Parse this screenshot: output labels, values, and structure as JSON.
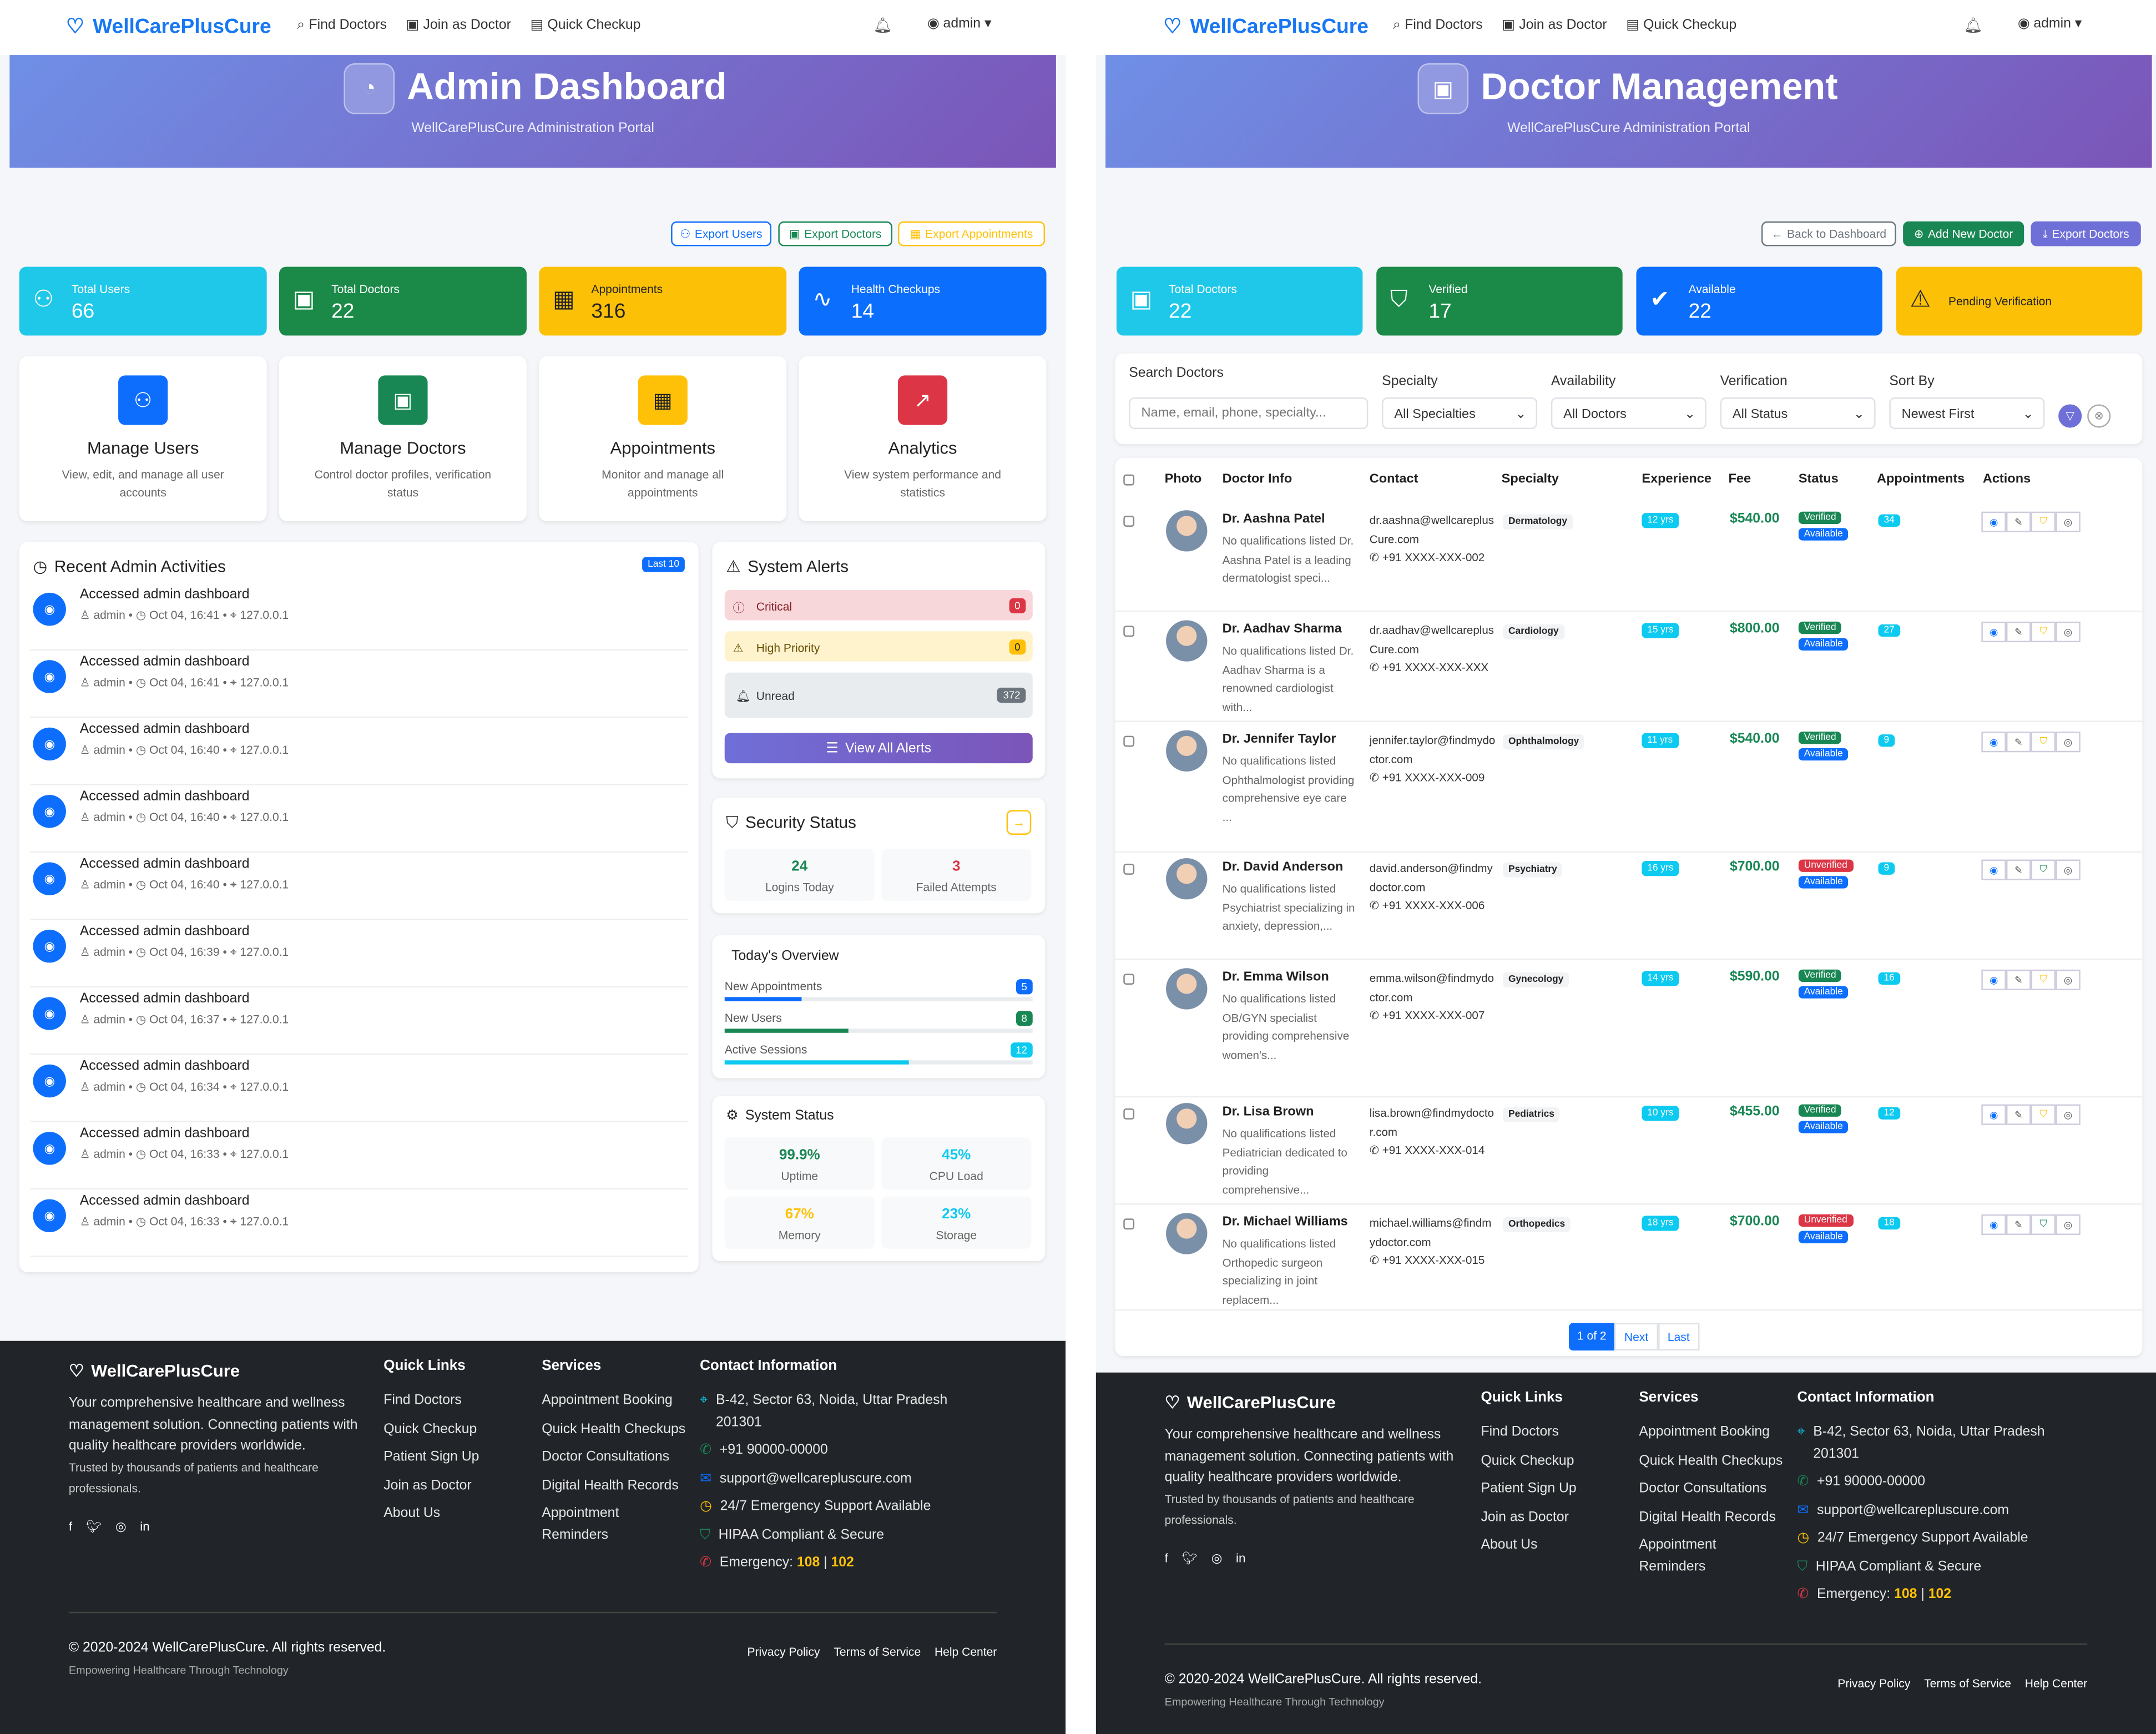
{
  "left": {
    "nav": {
      "brand": "WellCarePlusCure",
      "links": [
        "Find Doctors",
        "Join as Doctor",
        "Quick Checkup"
      ],
      "user": "admin"
    },
    "hero": {
      "title": "Admin Dashboard",
      "subtitle": "WellCarePlusCure Administration Portal"
    },
    "exports": [
      "Export Users",
      "Export Doctors",
      "Export Appointments"
    ],
    "stats": [
      {
        "label": "Total Users",
        "value": "66",
        "color": "#1fc8e8"
      },
      {
        "label": "Total Doctors",
        "value": "22",
        "color": "#1b8a48"
      },
      {
        "label": "Appointments",
        "value": "316",
        "color": "#fcc106"
      },
      {
        "label": "Health Checkups",
        "value": "14",
        "color": "#0b6efd"
      }
    ],
    "quick": [
      {
        "title": "Manage Users",
        "desc": "View, edit, and manage all user accounts",
        "color": "#0d6efd",
        "icon": "users-icon"
      },
      {
        "title": "Manage Doctors",
        "desc": "Control doctor profiles, verification status",
        "color": "#198754",
        "icon": "doctor-badge-icon"
      },
      {
        "title": "Appointments",
        "desc": "Monitor and manage all appointments",
        "color": "#ffc107",
        "icon": "calendar-icon"
      },
      {
        "title": "Analytics",
        "desc": "View system performance and statistics",
        "color": "#dc3545",
        "icon": "chart-icon"
      }
    ],
    "activities": {
      "title": "Recent Admin Activities",
      "badge": "Last 10",
      "items": [
        {
          "text": "Accessed admin dashboard",
          "user": "admin",
          "time": "Oct 04, 16:41",
          "ip": "127.0.0.1"
        },
        {
          "text": "Accessed admin dashboard",
          "user": "admin",
          "time": "Oct 04, 16:41",
          "ip": "127.0.0.1"
        },
        {
          "text": "Accessed admin dashboard",
          "user": "admin",
          "time": "Oct 04, 16:40",
          "ip": "127.0.0.1"
        },
        {
          "text": "Accessed admin dashboard",
          "user": "admin",
          "time": "Oct 04, 16:40",
          "ip": "127.0.0.1"
        },
        {
          "text": "Accessed admin dashboard",
          "user": "admin",
          "time": "Oct 04, 16:40",
          "ip": "127.0.0.1"
        },
        {
          "text": "Accessed admin dashboard",
          "user": "admin",
          "time": "Oct 04, 16:39",
          "ip": "127.0.0.1"
        },
        {
          "text": "Accessed admin dashboard",
          "user": "admin",
          "time": "Oct 04, 16:37",
          "ip": "127.0.0.1"
        },
        {
          "text": "Accessed admin dashboard",
          "user": "admin",
          "time": "Oct 04, 16:34",
          "ip": "127.0.0.1"
        },
        {
          "text": "Accessed admin dashboard",
          "user": "admin",
          "time": "Oct 04, 16:33",
          "ip": "127.0.0.1"
        },
        {
          "text": "Accessed admin dashboard",
          "user": "admin",
          "time": "Oct 04, 16:33",
          "ip": "127.0.0.1"
        }
      ]
    },
    "alerts": {
      "title": "System Alerts",
      "critical": {
        "label": "Critical",
        "count": "0"
      },
      "high": {
        "label": "High Priority",
        "count": "0"
      },
      "unread": {
        "label": "Unread",
        "count": "372"
      },
      "button": "View All Alerts"
    },
    "security": {
      "title": "Security Status",
      "logins": "24",
      "logins_label": "Logins Today",
      "failed": "3",
      "failed_label": "Failed Attempts"
    },
    "overview": {
      "title": "Today's Overview",
      "rows": [
        {
          "label": "New Appointments",
          "count": "5",
          "fill": 0.25,
          "color": "#0d6efd"
        },
        {
          "label": "New Users",
          "count": "8",
          "fill": 0.4,
          "color": "#198754"
        },
        {
          "label": "Active Sessions",
          "count": "12",
          "fill": 0.6,
          "color": "#0dcaf0"
        }
      ]
    },
    "system": {
      "title": "System Status",
      "metrics": [
        {
          "value": "99.9%",
          "label": "Uptime",
          "color": "#198754"
        },
        {
          "value": "45%",
          "label": "CPU Load",
          "color": "#0dcaf0"
        },
        {
          "value": "67%",
          "label": "Memory",
          "color": "#ffc107"
        },
        {
          "value": "23%",
          "label": "Storage",
          "color": "#0dcaf0"
        }
      ]
    }
  },
  "right": {
    "nav": {
      "brand": "WellCarePlusCure",
      "links": [
        "Find Doctors",
        "Join as Doctor",
        "Quick Checkup"
      ],
      "user": "admin"
    },
    "hero": {
      "title": "Doctor Management",
      "subtitle": "WellCarePlusCure Administration Portal"
    },
    "buttons": [
      "Back to Dashboard",
      "Add New Doctor",
      "Export Doctors"
    ],
    "stats": [
      {
        "label": "Total Doctors",
        "value": "22",
        "color": "#1fc8e8"
      },
      {
        "label": "Verified",
        "value": "17",
        "color": "#1b8a48"
      },
      {
        "label": "Available",
        "value": "22",
        "color": "#0b6efd"
      },
      {
        "label": "Pending Verification",
        "value": "",
        "color": "#fcc106"
      }
    ],
    "filters": {
      "search_label": "Search Doctors",
      "search_placeholder": "Name, email, phone, specialty...",
      "specialty_label": "Specialty",
      "specialty_value": "All Specialties",
      "availability_label": "Availability",
      "availability_value": "All Doctors",
      "verification_label": "Verification",
      "verification_value": "All Status",
      "sort_label": "Sort By",
      "sort_value": "Newest First"
    },
    "table": {
      "headers": [
        "Photo",
        "Doctor Info",
        "Contact",
        "Specialty",
        "Experience",
        "Fee",
        "Status",
        "Appointments",
        "Actions"
      ],
      "rows": [
        {
          "name": "Dr. Aashna Patel",
          "desc": "No qualifications listed Dr. Aashna Patel is a leading dermatologist speci...",
          "email": "dr.aashna@wellcareplusCure.com",
          "phone": "+91 XXXX-XXX-002",
          "specialty": "Dermatology",
          "exp": "12 yrs",
          "fee": "$540.00",
          "status": "Verified",
          "avail": "Available",
          "appts": "34"
        },
        {
          "name": "Dr. Aadhav Sharma",
          "desc": "No qualifications listed Dr. Aadhav Sharma is a renowned cardiologist with...",
          "email": "dr.aadhav@wellcareplusCure.com",
          "phone": "+91 XXXX-XXX-XXX",
          "specialty": "Cardiology",
          "exp": "15 yrs",
          "fee": "$800.00",
          "status": "Verified",
          "avail": "Available",
          "appts": "27"
        },
        {
          "name": "Dr. Jennifer Taylor",
          "desc": "No qualifications listed Ophthalmologist providing comprehensive eye care ...",
          "email": "jennifer.taylor@findmydoctor.com",
          "phone": "+91 XXXX-XXX-009",
          "specialty": "Ophthalmology",
          "exp": "11 yrs",
          "fee": "$540.00",
          "status": "Verified",
          "avail": "Available",
          "appts": "9"
        },
        {
          "name": "Dr. David Anderson",
          "desc": "No qualifications listed Psychiatrist specializing in anxiety, depression,...",
          "email": "david.anderson@findmydoctor.com",
          "phone": "+91 XXXX-XXX-006",
          "specialty": "Psychiatry",
          "exp": "16 yrs",
          "fee": "$700.00",
          "status": "Unverified",
          "avail": "Available",
          "appts": "9"
        },
        {
          "name": "Dr. Emma Wilson",
          "desc": "No qualifications listed OB/GYN specialist providing comprehensive women's...",
          "email": "emma.wilson@findmydoctor.com",
          "phone": "+91 XXXX-XXX-007",
          "specialty": "Gynecology",
          "exp": "14 yrs",
          "fee": "$590.00",
          "status": "Verified",
          "avail": "Available",
          "appts": "16"
        },
        {
          "name": "Dr. Lisa Brown",
          "desc": "No qualifications listed Pediatrician dedicated to providing comprehensive...",
          "email": "lisa.brown@findmydoctor.com",
          "phone": "+91 XXXX-XXX-014",
          "specialty": "Pediatrics",
          "exp": "10 yrs",
          "fee": "$455.00",
          "status": "Verified",
          "avail": "Available",
          "appts": "12"
        },
        {
          "name": "Dr. Michael Williams",
          "desc": "No qualifications listed Orthopedic surgeon specializing in joint replacem...",
          "email": "michael.williams@findmydoctor.com",
          "phone": "+91 XXXX-XXX-015",
          "specialty": "Orthopedics",
          "exp": "18 yrs",
          "fee": "$700.00",
          "status": "Unverified",
          "avail": "Available",
          "appts": "18"
        }
      ]
    },
    "pagination": {
      "current": "1 of 2",
      "next": "Next",
      "last": "Last"
    }
  },
  "footer": {
    "brand": "WellCarePlusCure",
    "desc": "Your comprehensive healthcare and wellness management solution. Connecting patients with quality healthcare providers worldwide.",
    "trust": "Trusted by thousands of patients and healthcare professionals.",
    "quick_title": "Quick Links",
    "quick": [
      "Find Doctors",
      "Quick Checkup",
      "Patient Sign Up",
      "Join as Doctor",
      "About Us"
    ],
    "services_title": "Services",
    "services": [
      "Appointment Booking",
      "Quick Health Checkups",
      "Doctor Consultations",
      "Digital Health Records",
      "Appointment Reminders"
    ],
    "contact_title": "Contact Information",
    "address": "B-42, Sector 63, Noida, Uttar Pradesh 201301",
    "phone": "+91 90000-00000",
    "email": "support@wellcarepluscure.com",
    "support": "24/7 Emergency Support Available",
    "hipaa": "HIPAA Compliant & Secure",
    "emergency_label": "Emergency:",
    "emergency_1": "108",
    "emergency_2": "102",
    "copyright": "© 2020-2024 WellCarePlusCure. All rights reserved.",
    "tagline": "Empowering Healthcare Through Technology",
    "links": [
      "Privacy Policy",
      "Terms of Service",
      "Help Center"
    ]
  }
}
